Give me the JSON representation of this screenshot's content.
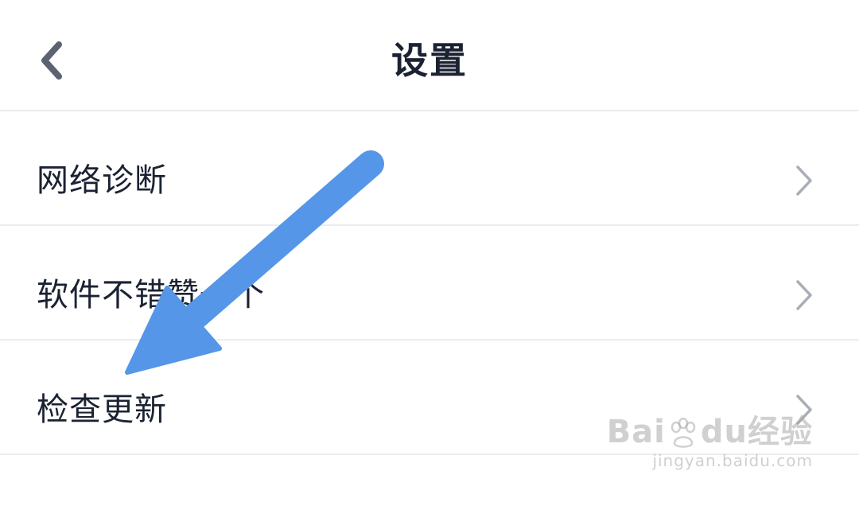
{
  "header": {
    "title": "设置",
    "back_icon": "chevron-left-icon"
  },
  "settings": {
    "items": [
      {
        "label": "网络诊断",
        "icon": "chevron-right-icon"
      },
      {
        "label": "软件不错赞一个",
        "icon": "chevron-right-icon"
      },
      {
        "label": "检查更新",
        "icon": "chevron-right-icon"
      }
    ]
  },
  "annotation": {
    "arrow_color": "#5596E8"
  },
  "watermark": {
    "brand_left": "Bai",
    "brand_right": "du",
    "brand_suffix": "经验",
    "url": "jingyan.baidu.com"
  },
  "colors": {
    "text": "#1B2232",
    "divider": "#ECECF0",
    "chevron": "#A9AEB8",
    "back": "#5C6270"
  }
}
